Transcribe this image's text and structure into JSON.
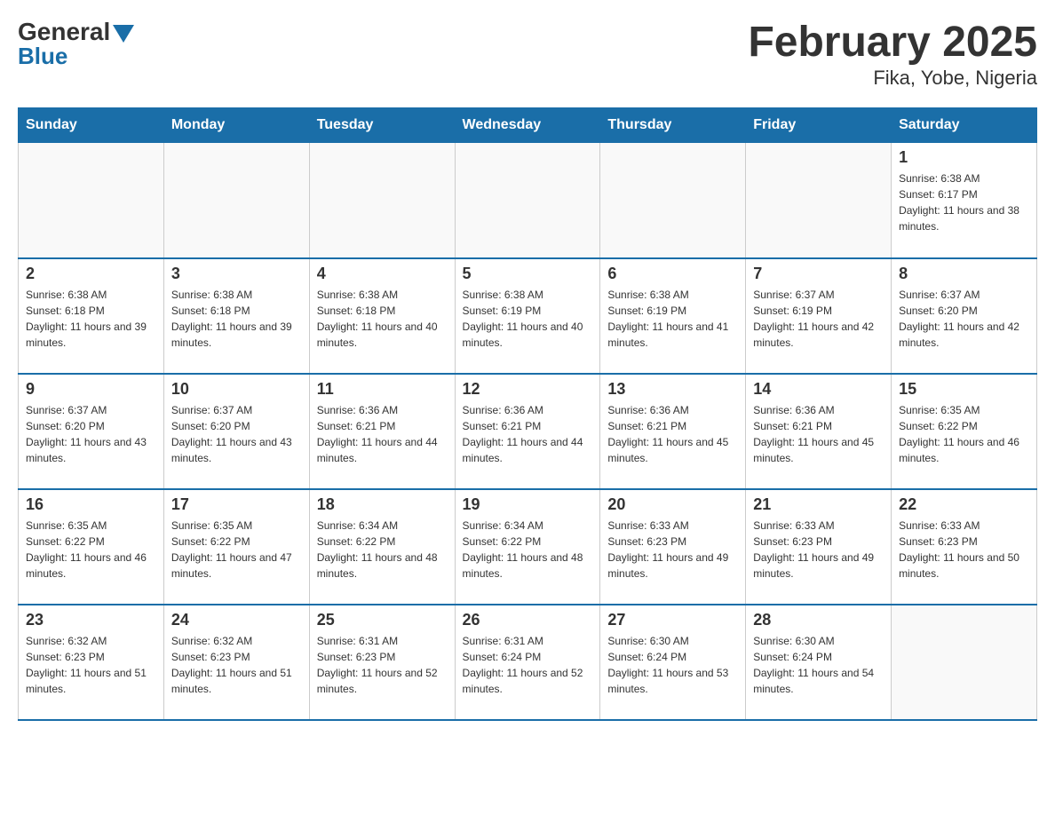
{
  "logo": {
    "line1_text": "General",
    "line2_text": "Blue"
  },
  "title": "February 2025",
  "subtitle": "Fika, Yobe, Nigeria",
  "days_of_week": [
    "Sunday",
    "Monday",
    "Tuesday",
    "Wednesday",
    "Thursday",
    "Friday",
    "Saturday"
  ],
  "weeks": [
    [
      {
        "day": "",
        "sunrise": "",
        "sunset": "",
        "daylight": ""
      },
      {
        "day": "",
        "sunrise": "",
        "sunset": "",
        "daylight": ""
      },
      {
        "day": "",
        "sunrise": "",
        "sunset": "",
        "daylight": ""
      },
      {
        "day": "",
        "sunrise": "",
        "sunset": "",
        "daylight": ""
      },
      {
        "day": "",
        "sunrise": "",
        "sunset": "",
        "daylight": ""
      },
      {
        "day": "",
        "sunrise": "",
        "sunset": "",
        "daylight": ""
      },
      {
        "day": "1",
        "sunrise": "Sunrise: 6:38 AM",
        "sunset": "Sunset: 6:17 PM",
        "daylight": "Daylight: 11 hours and 38 minutes."
      }
    ],
    [
      {
        "day": "2",
        "sunrise": "Sunrise: 6:38 AM",
        "sunset": "Sunset: 6:18 PM",
        "daylight": "Daylight: 11 hours and 39 minutes."
      },
      {
        "day": "3",
        "sunrise": "Sunrise: 6:38 AM",
        "sunset": "Sunset: 6:18 PM",
        "daylight": "Daylight: 11 hours and 39 minutes."
      },
      {
        "day": "4",
        "sunrise": "Sunrise: 6:38 AM",
        "sunset": "Sunset: 6:18 PM",
        "daylight": "Daylight: 11 hours and 40 minutes."
      },
      {
        "day": "5",
        "sunrise": "Sunrise: 6:38 AM",
        "sunset": "Sunset: 6:19 PM",
        "daylight": "Daylight: 11 hours and 40 minutes."
      },
      {
        "day": "6",
        "sunrise": "Sunrise: 6:38 AM",
        "sunset": "Sunset: 6:19 PM",
        "daylight": "Daylight: 11 hours and 41 minutes."
      },
      {
        "day": "7",
        "sunrise": "Sunrise: 6:37 AM",
        "sunset": "Sunset: 6:19 PM",
        "daylight": "Daylight: 11 hours and 42 minutes."
      },
      {
        "day": "8",
        "sunrise": "Sunrise: 6:37 AM",
        "sunset": "Sunset: 6:20 PM",
        "daylight": "Daylight: 11 hours and 42 minutes."
      }
    ],
    [
      {
        "day": "9",
        "sunrise": "Sunrise: 6:37 AM",
        "sunset": "Sunset: 6:20 PM",
        "daylight": "Daylight: 11 hours and 43 minutes."
      },
      {
        "day": "10",
        "sunrise": "Sunrise: 6:37 AM",
        "sunset": "Sunset: 6:20 PM",
        "daylight": "Daylight: 11 hours and 43 minutes."
      },
      {
        "day": "11",
        "sunrise": "Sunrise: 6:36 AM",
        "sunset": "Sunset: 6:21 PM",
        "daylight": "Daylight: 11 hours and 44 minutes."
      },
      {
        "day": "12",
        "sunrise": "Sunrise: 6:36 AM",
        "sunset": "Sunset: 6:21 PM",
        "daylight": "Daylight: 11 hours and 44 minutes."
      },
      {
        "day": "13",
        "sunrise": "Sunrise: 6:36 AM",
        "sunset": "Sunset: 6:21 PM",
        "daylight": "Daylight: 11 hours and 45 minutes."
      },
      {
        "day": "14",
        "sunrise": "Sunrise: 6:36 AM",
        "sunset": "Sunset: 6:21 PM",
        "daylight": "Daylight: 11 hours and 45 minutes."
      },
      {
        "day": "15",
        "sunrise": "Sunrise: 6:35 AM",
        "sunset": "Sunset: 6:22 PM",
        "daylight": "Daylight: 11 hours and 46 minutes."
      }
    ],
    [
      {
        "day": "16",
        "sunrise": "Sunrise: 6:35 AM",
        "sunset": "Sunset: 6:22 PM",
        "daylight": "Daylight: 11 hours and 46 minutes."
      },
      {
        "day": "17",
        "sunrise": "Sunrise: 6:35 AM",
        "sunset": "Sunset: 6:22 PM",
        "daylight": "Daylight: 11 hours and 47 minutes."
      },
      {
        "day": "18",
        "sunrise": "Sunrise: 6:34 AM",
        "sunset": "Sunset: 6:22 PM",
        "daylight": "Daylight: 11 hours and 48 minutes."
      },
      {
        "day": "19",
        "sunrise": "Sunrise: 6:34 AM",
        "sunset": "Sunset: 6:22 PM",
        "daylight": "Daylight: 11 hours and 48 minutes."
      },
      {
        "day": "20",
        "sunrise": "Sunrise: 6:33 AM",
        "sunset": "Sunset: 6:23 PM",
        "daylight": "Daylight: 11 hours and 49 minutes."
      },
      {
        "day": "21",
        "sunrise": "Sunrise: 6:33 AM",
        "sunset": "Sunset: 6:23 PM",
        "daylight": "Daylight: 11 hours and 49 minutes."
      },
      {
        "day": "22",
        "sunrise": "Sunrise: 6:33 AM",
        "sunset": "Sunset: 6:23 PM",
        "daylight": "Daylight: 11 hours and 50 minutes."
      }
    ],
    [
      {
        "day": "23",
        "sunrise": "Sunrise: 6:32 AM",
        "sunset": "Sunset: 6:23 PM",
        "daylight": "Daylight: 11 hours and 51 minutes."
      },
      {
        "day": "24",
        "sunrise": "Sunrise: 6:32 AM",
        "sunset": "Sunset: 6:23 PM",
        "daylight": "Daylight: 11 hours and 51 minutes."
      },
      {
        "day": "25",
        "sunrise": "Sunrise: 6:31 AM",
        "sunset": "Sunset: 6:23 PM",
        "daylight": "Daylight: 11 hours and 52 minutes."
      },
      {
        "day": "26",
        "sunrise": "Sunrise: 6:31 AM",
        "sunset": "Sunset: 6:24 PM",
        "daylight": "Daylight: 11 hours and 52 minutes."
      },
      {
        "day": "27",
        "sunrise": "Sunrise: 6:30 AM",
        "sunset": "Sunset: 6:24 PM",
        "daylight": "Daylight: 11 hours and 53 minutes."
      },
      {
        "day": "28",
        "sunrise": "Sunrise: 6:30 AM",
        "sunset": "Sunset: 6:24 PM",
        "daylight": "Daylight: 11 hours and 54 minutes."
      },
      {
        "day": "",
        "sunrise": "",
        "sunset": "",
        "daylight": ""
      }
    ]
  ]
}
